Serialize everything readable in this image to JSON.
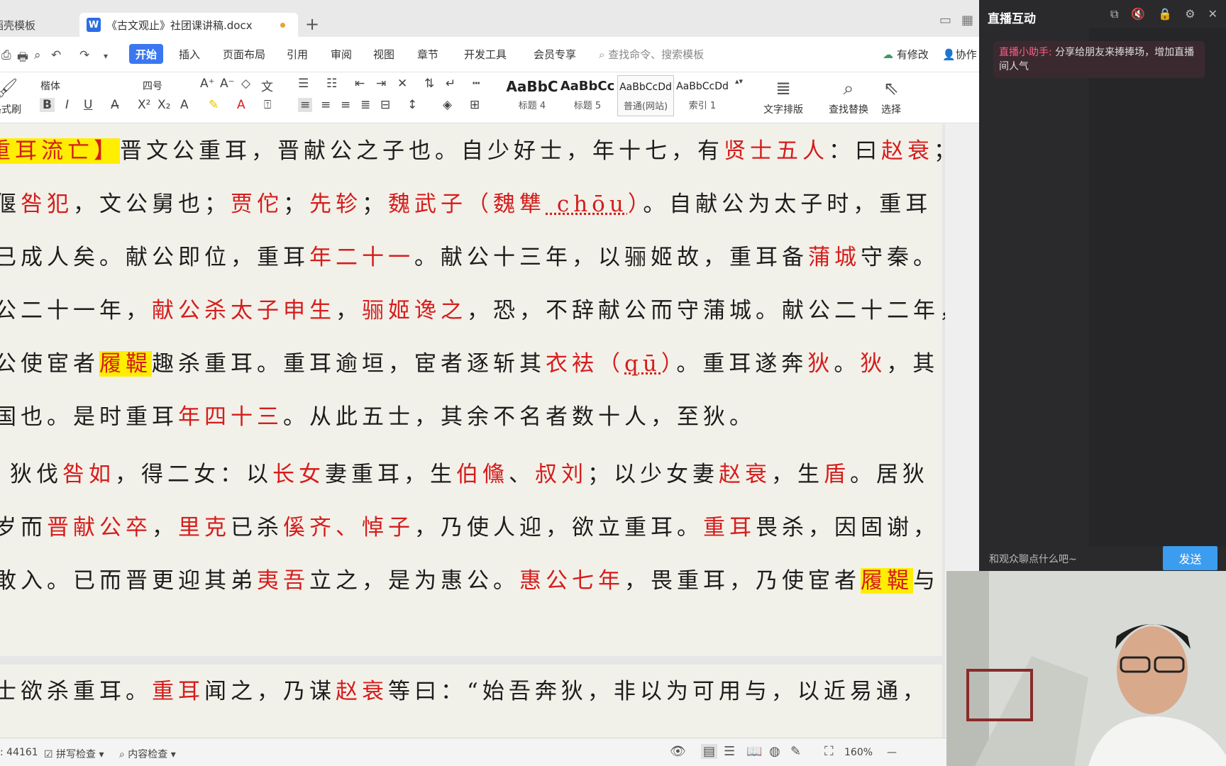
{
  "tabs": {
    "template_tab": "稻壳模板",
    "doc_tab": "《古文观止》社团课讲稿.docx",
    "add": "+"
  },
  "menu": {
    "start": "开始",
    "insert": "插入",
    "layout": "页面布局",
    "reference": "引用",
    "review": "审阅",
    "view": "视图",
    "chapter": "章节",
    "dev": "开发工具",
    "member": "会员专享",
    "search_placeholder": "查找命令、搜索模板",
    "has_changes": "有修改",
    "collab": "协作"
  },
  "toolbar": {
    "format_painter": "格式刷",
    "font_name": "楷体",
    "font_size": "四号",
    "styles": [
      {
        "sample": "AaBbC",
        "name": "标题 4"
      },
      {
        "sample": "AaBbCc",
        "name": "标题 5"
      },
      {
        "sample": "AaBbCcDd",
        "name": "普通(网站)"
      },
      {
        "sample": "AaBbCcDd",
        "name": "索引 1"
      }
    ],
    "text_layout": "文字排版",
    "find_replace": "查找替换",
    "select": "选择"
  },
  "document": {
    "lines": [
      [
        {
          "t": "重耳流亡】",
          "c": "r",
          "h": true
        },
        {
          "t": "晋文公重耳，晋献公之子也。自少好士，年十七，有"
        },
        {
          "t": "贤士五人",
          "c": "r"
        },
        {
          "t": "：曰"
        },
        {
          "t": "赵衰",
          "c": "r"
        },
        {
          "t": "；"
        }
      ],
      [
        {
          "t": "偃"
        },
        {
          "t": "咎犯",
          "c": "r"
        },
        {
          "t": "，文公舅也；"
        },
        {
          "t": "贾佗",
          "c": "r"
        },
        {
          "t": "；"
        },
        {
          "t": "先轸",
          "c": "r"
        },
        {
          "t": "；"
        },
        {
          "t": "魏武子（魏犨",
          "c": "r"
        },
        {
          "t": " chōu",
          "c": "r",
          "p": true
        },
        {
          "t": "）",
          "c": "r"
        },
        {
          "t": "。自献公为太子时，重耳"
        }
      ],
      [
        {
          "t": "已成人矣。献公即位，重耳"
        },
        {
          "t": "年二十一",
          "c": "r"
        },
        {
          "t": "。献公十三年，以骊姬故，重耳备"
        },
        {
          "t": "蒲城",
          "c": "r"
        },
        {
          "t": "守秦。"
        }
      ],
      [
        {
          "t": "公二十一年，"
        },
        {
          "t": "献公杀太子申生",
          "c": "r"
        },
        {
          "t": "，"
        },
        {
          "t": "骊姬谗之",
          "c": "r"
        },
        {
          "t": "，恐，不辞献公而守蒲城。献公二十二年，"
        }
      ],
      [
        {
          "t": "公使宦者"
        },
        {
          "t": "履鞮",
          "c": "r",
          "h": true
        },
        {
          "t": "趣杀重耳。重耳逾垣，宦者逐斩其"
        },
        {
          "t": "衣袪（",
          "c": "r"
        },
        {
          "t": "qū",
          "c": "r",
          "p": true
        },
        {
          "t": "）",
          "c": "r"
        },
        {
          "t": "。重耳遂奔"
        },
        {
          "t": "狄",
          "c": "r"
        },
        {
          "t": "。"
        },
        {
          "t": "狄",
          "c": "r"
        },
        {
          "t": "，其"
        }
      ],
      [
        {
          "t": "国也。是时重耳"
        },
        {
          "t": "年四十三",
          "c": "r"
        },
        {
          "t": "。从此五士，其余不名者数十人，至狄。"
        }
      ],
      [
        {
          "t": "狄伐"
        },
        {
          "t": "咎如",
          "c": "r"
        },
        {
          "t": "，得二女：以"
        },
        {
          "t": "长女",
          "c": "r"
        },
        {
          "t": "妻重耳，生"
        },
        {
          "t": "伯儵",
          "c": "r"
        },
        {
          "t": "、"
        },
        {
          "t": "叔刘",
          "c": "r"
        },
        {
          "t": "；以少女妻"
        },
        {
          "t": "赵衰",
          "c": "r"
        },
        {
          "t": "，生"
        },
        {
          "t": "盾",
          "c": "r"
        },
        {
          "t": "。居狄"
        }
      ],
      [
        {
          "t": "岁而"
        },
        {
          "t": "晋献公卒",
          "c": "r"
        },
        {
          "t": "，"
        },
        {
          "t": "里克",
          "c": "r"
        },
        {
          "t": "已杀"
        },
        {
          "t": "傒齐、悼子",
          "c": "r"
        },
        {
          "t": "，乃使人迎，欲立重耳。"
        },
        {
          "t": "重耳",
          "c": "r"
        },
        {
          "t": "畏杀，因固谢，"
        }
      ],
      [
        {
          "t": "敢入。已而晋更迎其弟"
        },
        {
          "t": "夷吾",
          "c": "r"
        },
        {
          "t": "立之，是为惠公。"
        },
        {
          "t": "惠公七年",
          "c": "r"
        },
        {
          "t": "，畏重耳，乃使宦者"
        },
        {
          "t": "履鞮",
          "c": "r",
          "h": true
        },
        {
          "t": "与"
        }
      ],
      [
        {
          "t": "士欲杀重耳。"
        },
        {
          "t": "重耳",
          "c": "r"
        },
        {
          "t": "闻之，乃谋"
        },
        {
          "t": "赵衰",
          "c": "r"
        },
        {
          "t": "等曰：“始吾奔狄，非以为可用与，以近易通，"
        }
      ]
    ]
  },
  "status": {
    "word_count": ": 44161",
    "spell_check": "拼写检查",
    "content_check": "内容检查",
    "zoom": "160%"
  },
  "live": {
    "title": "直播互动",
    "assistant_tag": "直播小助手:",
    "assistant_msg": "分享给朋友来捧捧场，增加直播间人气",
    "chat_placeholder": "和观众聊点什么吧~",
    "send": "发送"
  },
  "colors": {
    "accent": "#3a77f0",
    "emphasis_red": "#d51d1d",
    "highlight_yellow": "#ffee00",
    "send_blue": "#3b9df0"
  }
}
